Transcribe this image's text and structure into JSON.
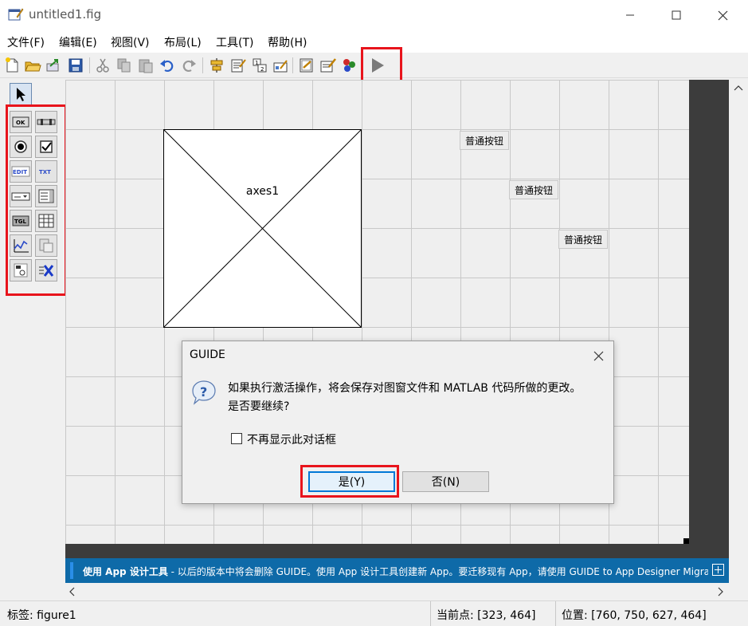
{
  "window": {
    "title": "untitled1.fig"
  },
  "menubar": {
    "items": [
      "文件(F)",
      "编辑(E)",
      "视图(V)",
      "布局(L)",
      "工具(T)",
      "帮助(H)"
    ]
  },
  "toolbar": {
    "buttons": [
      "new-figure-icon",
      "open-icon",
      "export-icon",
      "save-icon",
      "cut-icon",
      "copy-icon",
      "paste-icon",
      "undo-icon",
      "redo-icon",
      "align-icon",
      "menu-editor-icon",
      "tab-order-icon",
      "toolbar-editor-icon",
      "editor-icon",
      "property-inspector-icon",
      "object-browser-icon",
      "run-icon"
    ]
  },
  "palette": {
    "items": [
      "select-icon",
      "push-button-icon",
      "slider-icon",
      "radio-button-icon",
      "checkbox-icon",
      "edit-text-icon",
      "static-text-icon",
      "popup-menu-icon",
      "listbox-icon",
      "toggle-button-icon",
      "table-icon",
      "axes-icon",
      "panel-icon",
      "button-group-icon",
      "activex-icon"
    ],
    "labels": {
      "ok": "OK",
      "edit": "EDIT",
      "txt": "TXT",
      "tgl": "TGL"
    }
  },
  "canvas": {
    "axes_label": "axes1",
    "push_buttons": [
      "普通按钮",
      "普通按钮",
      "普通按钮"
    ]
  },
  "dialog": {
    "title": "GUIDE",
    "message_line1": "如果执行激活操作，将会保存对图窗文件和 MATLAB 代码所做的更改。",
    "message_line2": "是否要继续?",
    "checkbox_label": "不再显示此对话框",
    "checkbox_checked": false,
    "yes_label": "是(Y)",
    "no_label": "否(N)"
  },
  "banner": {
    "bold_text": "使用 App 设计工具",
    "text": " - 以后的版本中将会删除 GUIDE。使用 App 设计工具创建新 App。要迁移现有 App，请使用 GUIDE to App Designer Migration..."
  },
  "statusbar": {
    "tag": "标签: figure1",
    "current_point": "当前点:  [323, 464]",
    "position": "位置: [760, 750, 627, 464]"
  },
  "colors": {
    "highlight": "#e8141c",
    "banner": "#0e6aa8",
    "dark_area": "#3c3c3c"
  }
}
